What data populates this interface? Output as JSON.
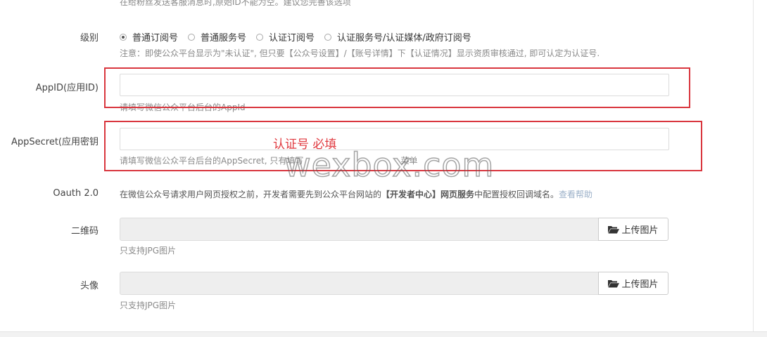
{
  "top_notice": "在给粉丝发送客服消息时,原始ID不能为空。建议您完善该选项",
  "level": {
    "label": "级别",
    "options": [
      "普通订阅号",
      "普通服务号",
      "认证订阅号",
      "认证服务号/认证媒体/政府订阅号"
    ],
    "selected_index": 0,
    "note": "注意：即使公众平台显示为\"未认证\", 但只要【公众号设置】/【账号详情】下【认证情况】显示资质审核通过, 即可认定为认证号."
  },
  "appid": {
    "label": "AppID(应用ID)",
    "value": "",
    "help": "请填写微信公众平台后台的AppId"
  },
  "appsecret": {
    "label": "AppSecret(应用密钥",
    "value": "",
    "help_prefix": "请填写微信公众平台后台的AppSecret, 只有填写",
    "help_suffix": "菜单"
  },
  "annotation": {
    "text": "认证号 必填",
    "color": "#e0393f"
  },
  "watermark": "wexbox.com",
  "oauth": {
    "label": "Oauth 2.0",
    "help_prefix": "在微信公众号请求用户网页授权之前，开发者需要先到公众平台网站的",
    "help_bold": "【开发者中心】网页服务",
    "help_suffix": "中配置授权回调域名。",
    "help_link": "查看帮助"
  },
  "qrcode": {
    "label": "二维码",
    "button": "上传图片",
    "button_icon": "folder-open-icon",
    "help": "只支持JPG图片"
  },
  "avatar": {
    "label": "头像",
    "button": "上传图片",
    "button_icon": "folder-open-icon",
    "help": "只支持JPG图片"
  }
}
